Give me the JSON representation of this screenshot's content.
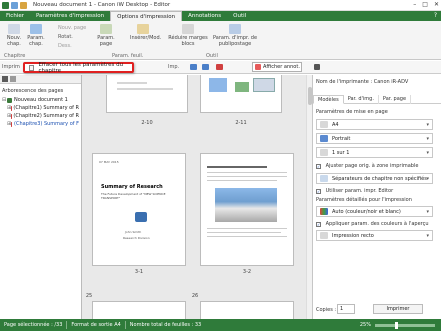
{
  "window": {
    "title": "Nouveau document 1 - Canon iW Desktop - Editor",
    "controls": [
      "–",
      "□",
      "✕"
    ]
  },
  "menu": {
    "tabs": [
      "Fichier",
      "Paramètres d'impression",
      "Options d'impression",
      "Annotations",
      "Outil"
    ],
    "help": "?"
  },
  "ribbon": {
    "nouveau_chap": "Nouv. chap.",
    "param_chap": "Param. chap.",
    "nouv_page": "Nouv. page",
    "rotat": "Rotat.",
    "dess": "Dess.",
    "param_page": "Param. page",
    "insert_mod": "Insérer/Mod.",
    "reduire": "Réduire marges blocs",
    "param_impr": "Param. d'impr. de publipostage",
    "group_chapitre": "Chapitre",
    "group_param_feuil": "Param. feuil.",
    "group_outil": "Outil"
  },
  "tooltip": {
    "text": "Effacer tous les paramètres du chapitre"
  },
  "toolbar": {
    "imprimer_label": "Imprim",
    "imp_label": "Imp.",
    "afficher_annot": "Afficher annot."
  },
  "left_pane": {
    "header": "Arborescence des pages",
    "nodes": [
      {
        "label": "Nouveau document 1",
        "expand": "⊟",
        "selected": false
      },
      {
        "label": "(Chapitre1) Summary of R",
        "expand": "⊞",
        "selected": false
      },
      {
        "label": "(Chapitre2) Summary of R",
        "expand": "⊞",
        "selected": false
      },
      {
        "label": "(Chapitre3) Summary of F",
        "expand": "⊞",
        "selected": true
      }
    ]
  },
  "viewer": {
    "page_labels": [
      "2-10",
      "2-11",
      "3-1",
      "3-2",
      "25",
      "26"
    ],
    "page1": {
      "title": "Summary of Research",
      "subtitle": "The Future Development of \"NEW SCIENCE TRANSPORT\"",
      "date": "07 MAY 2015",
      "author": "John Smith",
      "dept": "Research Division"
    }
  },
  "right_pane": {
    "printer_label": "Nom de l'imprimante :",
    "printer_name": "Canon iR-ADV",
    "tabs": [
      "Modèles",
      "Par. d'img.",
      "Par. page"
    ],
    "section_mise_en_page": "Paramètres de mise en page",
    "paper": "A4",
    "orientation": "Portrait",
    "pages_per_sheet": "1 sur 1",
    "adjust_label": "Ajuster page orig. à zone imprimable",
    "chapter_sep": "Séparateurs de chapitre non spécifiés",
    "use_editor_label": "Utiliser param. impr. Editor",
    "section_detail": "Paramètres détaillés pour l'impression",
    "color_mode": "Auto (couleur/noir et blanc)",
    "apply_color_label": "Appliquer param. des couleurs à l'aperçu",
    "impression": "Impression recto",
    "copies_label": "Copies :",
    "copies_value": "1",
    "print_button": "Imprimer"
  },
  "statusbar": {
    "page_sel": "Page sélectionnée : /33",
    "format": "Format de sortie A4",
    "total": "Nombre total de feuilles : 33",
    "zoom": "25%"
  },
  "colors": {
    "accent": "#2f7b3a",
    "tooltip_border": "#e02020",
    "selection": "#1a4fb0"
  }
}
